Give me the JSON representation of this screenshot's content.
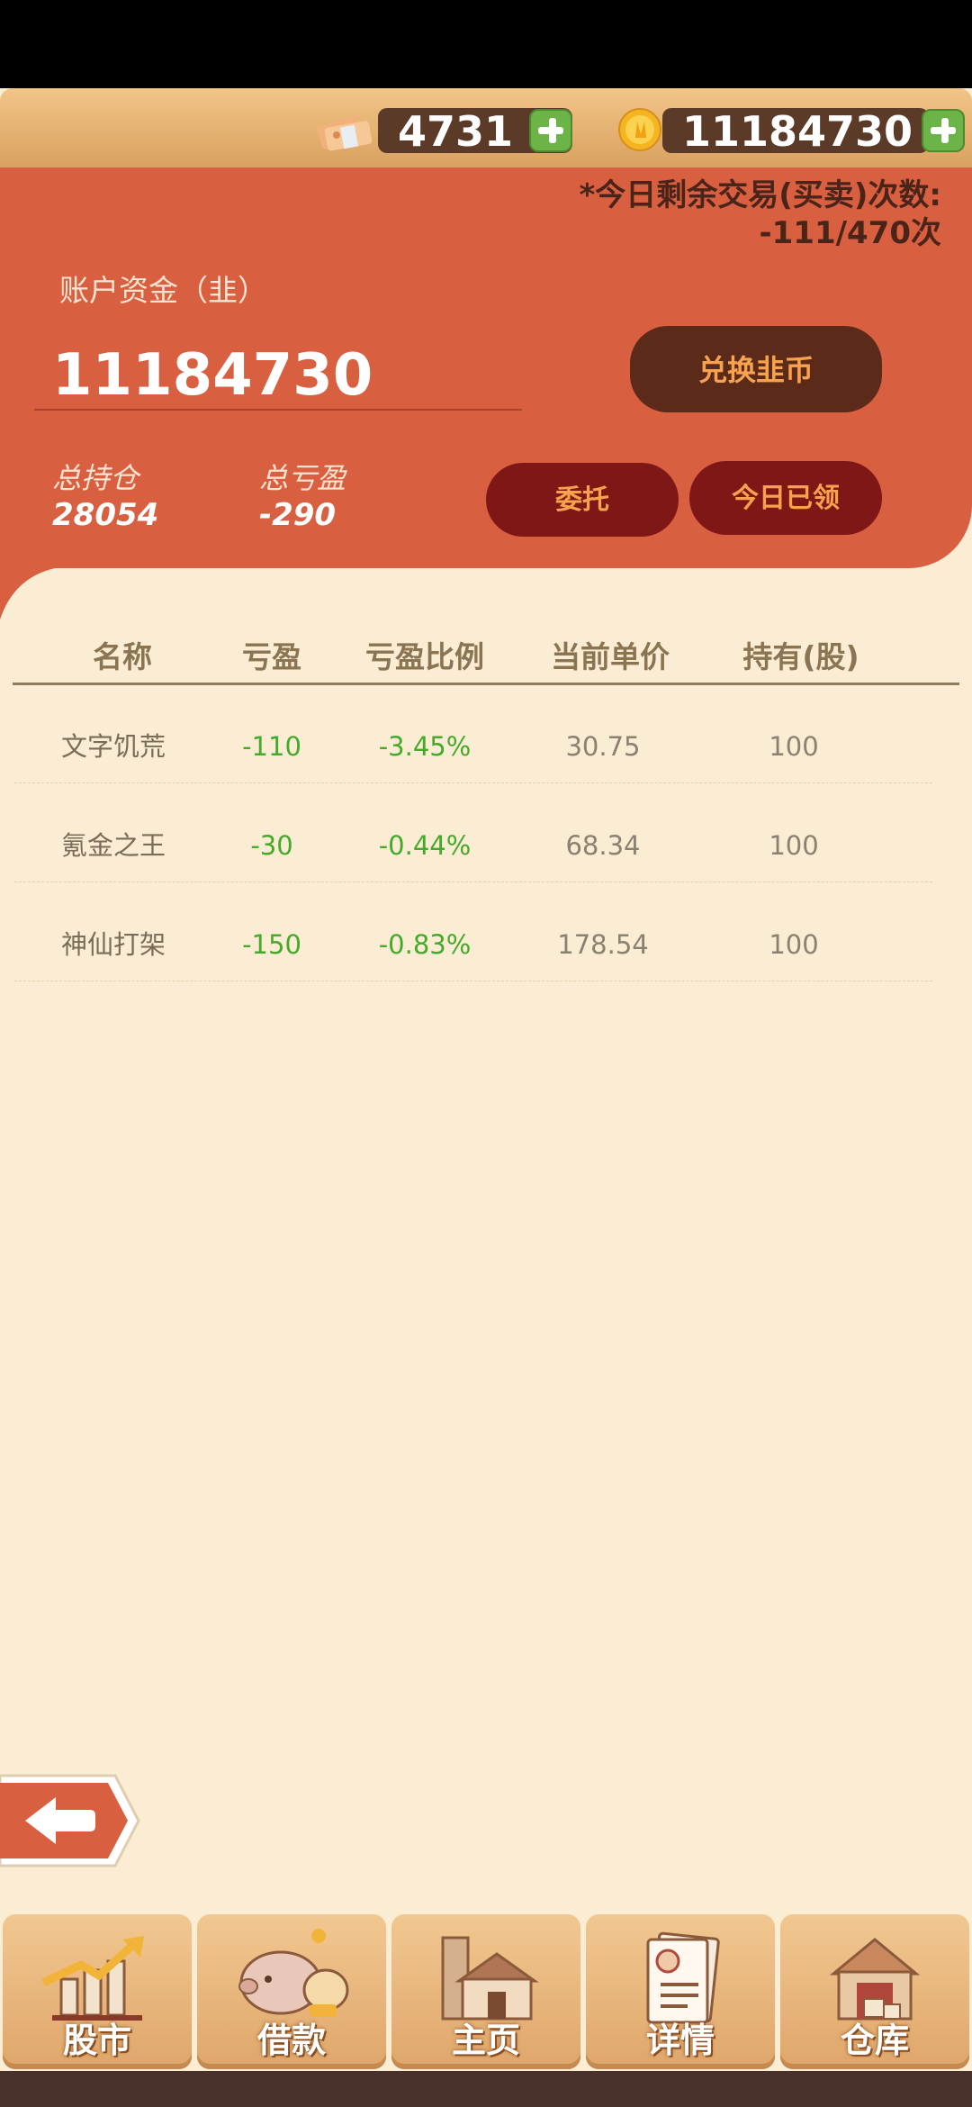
{
  "topbar": {
    "cash_amount": "4731",
    "coin_amount": "11184730"
  },
  "account": {
    "trades_remaining_line1": "*今日剩余交易(买卖)次数:",
    "trades_remaining_line2": "-111/470次",
    "funds_label": "账户资金（韭）",
    "funds_value": "11184730",
    "exchange_button": "兑换韭币",
    "total_position_label": "总持仓",
    "total_position_value": "28054",
    "total_pnl_label": "总亏盈",
    "total_pnl_value": "-290",
    "entrust_button": "委托",
    "claimed_button": "今日已领"
  },
  "table": {
    "headers": [
      "名称",
      "亏盈",
      "亏盈比例",
      "当前单价",
      "持有(股)"
    ],
    "rows": [
      {
        "name": "文字饥荒",
        "pnl": "-110",
        "ratio": "-3.45%",
        "price": "30.75",
        "held": "100"
      },
      {
        "name": "氪金之王",
        "pnl": "-30",
        "ratio": "-0.44%",
        "price": "68.34",
        "held": "100"
      },
      {
        "name": "神仙打架",
        "pnl": "-150",
        "ratio": "-0.83%",
        "price": "178.54",
        "held": "100"
      }
    ]
  },
  "nav": {
    "items": [
      {
        "label": "股市",
        "icon": "stock-chart-icon"
      },
      {
        "label": "借款",
        "icon": "piggy-bank-icon"
      },
      {
        "label": "主页",
        "icon": "house-icon"
      },
      {
        "label": "详情",
        "icon": "profile-document-icon"
      },
      {
        "label": "仓库",
        "icon": "warehouse-icon"
      }
    ]
  },
  "colors": {
    "panel": "#d95f41",
    "background": "#faedd3",
    "loss_green": "#45a92a",
    "button_dark": "#5c2a18",
    "button_red": "#7e1716"
  }
}
